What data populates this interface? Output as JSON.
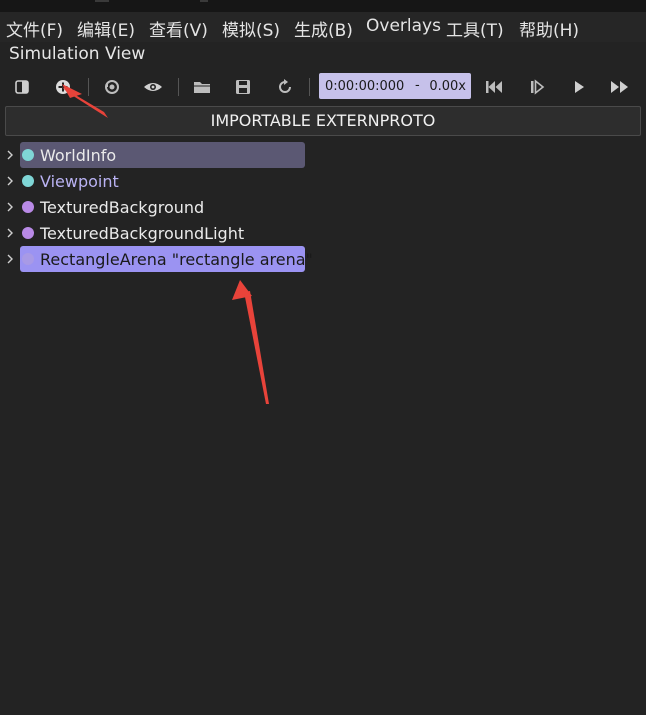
{
  "menu": [
    {
      "label": "文件(F)"
    },
    {
      "label": "编辑(E)"
    },
    {
      "label": "查看(V)"
    },
    {
      "label": "模拟(S)"
    },
    {
      "label": "生成(B)"
    },
    {
      "label": "Overlays"
    },
    {
      "label": "工具(T)"
    },
    {
      "label": "帮助(H)"
    }
  ],
  "panel": {
    "title": "Simulation View"
  },
  "toolbar": {
    "buttons": [
      {
        "icon": "toggle-panel-icon"
      },
      {
        "icon": "add-node-icon"
      },
      {
        "icon": "reset-view-icon"
      },
      {
        "icon": "eye-icon"
      },
      {
        "icon": "open-folder-icon"
      },
      {
        "icon": "save-icon"
      },
      {
        "icon": "reload-icon"
      }
    ],
    "time": "0:00:00:000",
    "separator": "-",
    "speed": "0.00x",
    "playback": [
      {
        "icon": "reset-simulation-icon"
      },
      {
        "icon": "step-icon"
      },
      {
        "icon": "play-icon"
      },
      {
        "icon": "fast-forward-icon"
      }
    ]
  },
  "import_label": "IMPORTABLE EXTERNPROTO",
  "tree": [
    {
      "label": "WorldInfo",
      "dot_color": "#7fd6d6",
      "label_color": "#eaeaea",
      "highlight": "#5b5873"
    },
    {
      "label": "Viewpoint",
      "dot_color": "#7fd6d6",
      "label_color": "#b9b2f2",
      "highlight": ""
    },
    {
      "label": "TexturedBackground",
      "dot_color": "#b98ae6",
      "label_color": "#eaeaea",
      "highlight": ""
    },
    {
      "label": "TexturedBackgroundLight",
      "dot_color": "#b98ae6",
      "label_color": "#eaeaea",
      "highlight": ""
    },
    {
      "label": "RectangleArena \"rectangle arena\"",
      "dot_color": "#a89ae6",
      "label_color": "#1a1a1a",
      "highlight": "#9b93f2"
    }
  ],
  "colors": {
    "background": "#232323",
    "arrow": "#e8433a",
    "time_bg": "#c6c1ea"
  }
}
